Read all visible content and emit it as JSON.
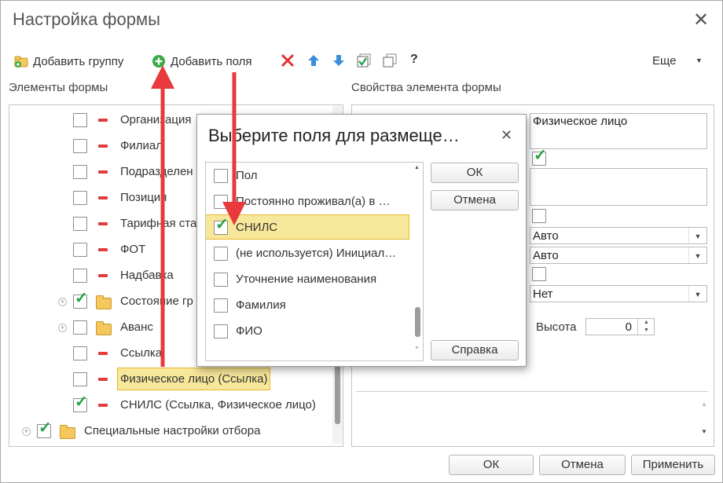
{
  "window": {
    "title": "Настройка формы",
    "close": "✕"
  },
  "toolbar": {
    "add_group": "Добавить группу",
    "add_field": "Добавить поля",
    "help": "?",
    "more": "Еще",
    "more_arrow": "▼"
  },
  "left": {
    "header": "Элементы формы",
    "items": [
      {
        "text": "Организация",
        "checked": false,
        "type": "field"
      },
      {
        "text": "Филиал",
        "checked": false,
        "type": "field"
      },
      {
        "text": "Подразделен",
        "checked": false,
        "type": "field"
      },
      {
        "text": "Позиция",
        "checked": false,
        "type": "field"
      },
      {
        "text": "Тарифная ста",
        "checked": false,
        "type": "field"
      },
      {
        "text": "ФОТ",
        "checked": false,
        "type": "field"
      },
      {
        "text": "Надбавка",
        "checked": false,
        "type": "field"
      },
      {
        "text": "Состояние гр",
        "checked": true,
        "type": "group"
      },
      {
        "text": "Аванс",
        "checked": false,
        "type": "group"
      },
      {
        "text": "Ссылка",
        "checked": false,
        "type": "field"
      },
      {
        "text": "Физическое лицо (Ссылка)",
        "checked": false,
        "type": "field"
      },
      {
        "text": "СНИЛС (Ссылка, Физическое лицо)",
        "checked": true,
        "type": "field"
      },
      {
        "text": "Специальные настройки отбора",
        "checked": true,
        "type": "group"
      }
    ],
    "expand_glyph": "+"
  },
  "right": {
    "header": "Свойства элемента формы",
    "title_value": "Физическое лицо",
    "dropdown1": "Авто",
    "dropdown2": "Авто",
    "dropdown3": "Нет",
    "height_label": "Высота",
    "height_value": "0",
    "spin_up": "▲",
    "spin_down": "▼",
    "scroll_up": "▲",
    "scroll_down": "▼"
  },
  "dialog": {
    "title": "Выберите поля для размеще…",
    "close": "✕",
    "items": [
      {
        "text": "Пол",
        "checked": false
      },
      {
        "text": "Постоянно проживал(а) в …",
        "checked": false
      },
      {
        "text": "СНИЛС",
        "checked": true
      },
      {
        "text": "(не используется) Инициал…",
        "checked": false
      },
      {
        "text": "Уточнение наименования",
        "checked": false
      },
      {
        "text": "Фамилия",
        "checked": false
      },
      {
        "text": "ФИО",
        "checked": false
      }
    ],
    "ok": "ОК",
    "cancel": "Отмена",
    "help": "Справка",
    "scroll_up": "▲",
    "scroll_down": "▼"
  },
  "footer": {
    "ok": "ОК",
    "cancel": "Отмена",
    "apply": "Применить"
  },
  "colors": {
    "arrow": "#e8393c",
    "check": "#26a043",
    "highlight": "#f7e79a",
    "highlight_border": "#e8b82e"
  }
}
